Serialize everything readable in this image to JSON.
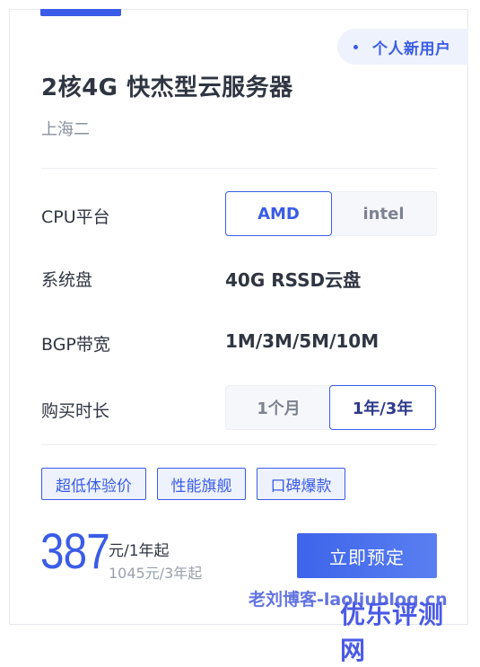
{
  "corner_tag": "个人新用户",
  "title": "2核4G 快杰型云服务器",
  "region": "上海二",
  "rows": {
    "cpu": {
      "label": "CPU平台",
      "options": [
        "AMD",
        "intel"
      ],
      "selected": "AMD"
    },
    "disk": {
      "label": "系统盘",
      "value": "40G RSSD云盘"
    },
    "bandwidth": {
      "label": "BGP带宽",
      "value": "1M/3M/5M/10M"
    },
    "duration": {
      "label": "购买时长",
      "options": [
        "1个月",
        "1年/3年"
      ],
      "selected": "1年/3年"
    }
  },
  "badges": [
    "超低体验价",
    "性能旗舰",
    "口碑爆款"
  ],
  "price": {
    "amount": "387",
    "unit": "元/1年起",
    "original": "1045元/3年起"
  },
  "buy_label": "立即预定",
  "watermarks": {
    "blog": "老刘博客-laoliublog.cn",
    "site": "优乐评测网"
  },
  "colors": {
    "accent": "#3a5ce6",
    "text": "#2f3542",
    "muted": "#8a909d"
  }
}
